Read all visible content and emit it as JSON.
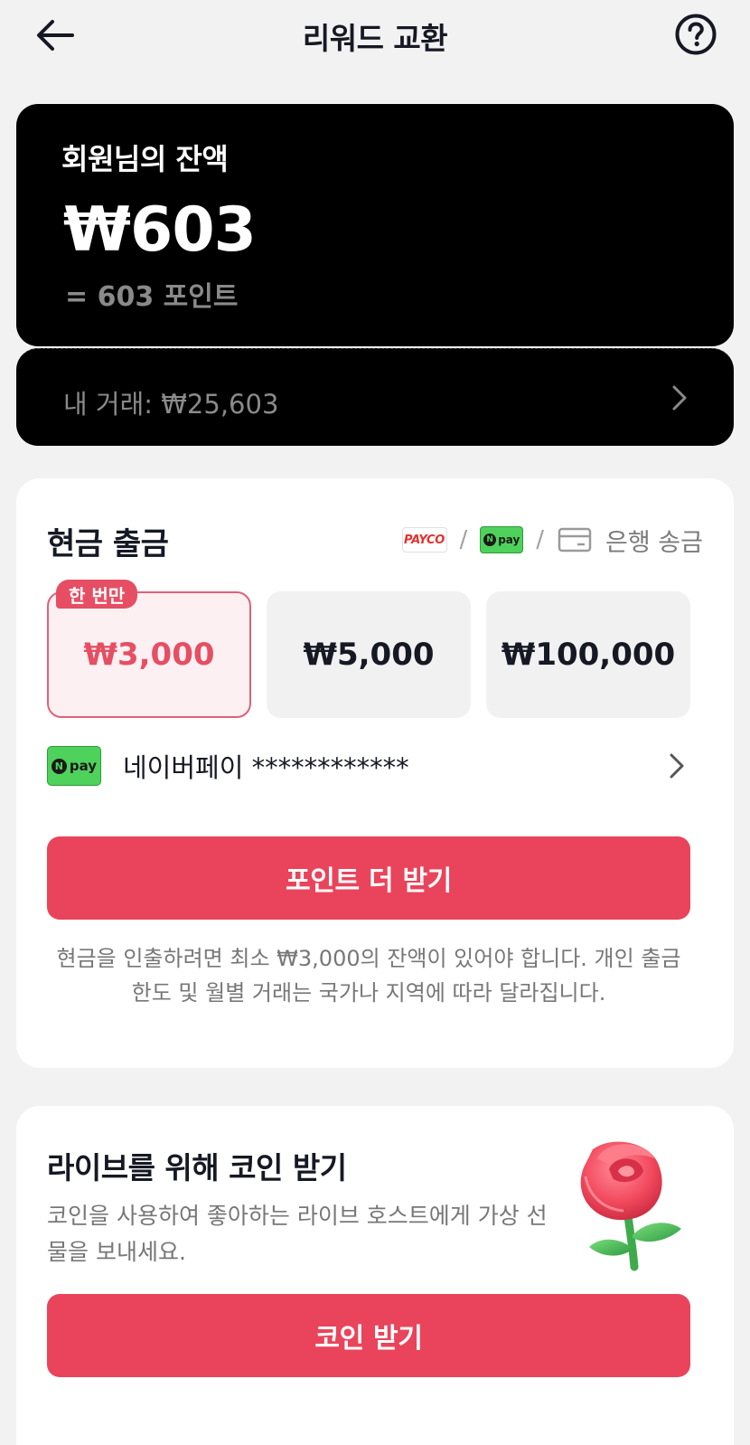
{
  "header": {
    "title": "리워드 교환",
    "back_icon": "arrow-left-icon",
    "help_icon": "question-circle-icon"
  },
  "balance": {
    "label": "회원님의 잔액",
    "amount": "₩603",
    "points": "= 603 포인트",
    "transactions": "내 거래: ₩25,603"
  },
  "cash": {
    "title": "현금 출금",
    "methods": {
      "payco": "PAYCO",
      "npay_n": "N",
      "npay_text": "pay",
      "bank": "은행 송금"
    },
    "badge": "한 번만",
    "options": [
      "₩3,000",
      "₩5,000",
      "₩100,000"
    ],
    "selected_option": "₩3,000",
    "account": {
      "logo_n": "N",
      "logo_text": "pay",
      "text": "네이버페이 ************"
    },
    "button": "포인트 더 받기",
    "notice": "현금을 인출하려면 최소 ₩3,000의 잔액이 있어야 합니다. 개인 출금 한도 및 월별 거래는 국가나 지역에 따라 달라집니다."
  },
  "coins": {
    "title": "라이브를 위해 코인 받기",
    "description": "코인을 사용하여 좋아하는 라이브 호스트에게 가상 선물을 보내세요.",
    "button": "코인 받기",
    "image": "rose-gift-icon"
  },
  "colors": {
    "accent": "#e9445b",
    "card_dark": "#000000",
    "background": "#f2f2f2",
    "npay_green": "#4fd25b"
  }
}
